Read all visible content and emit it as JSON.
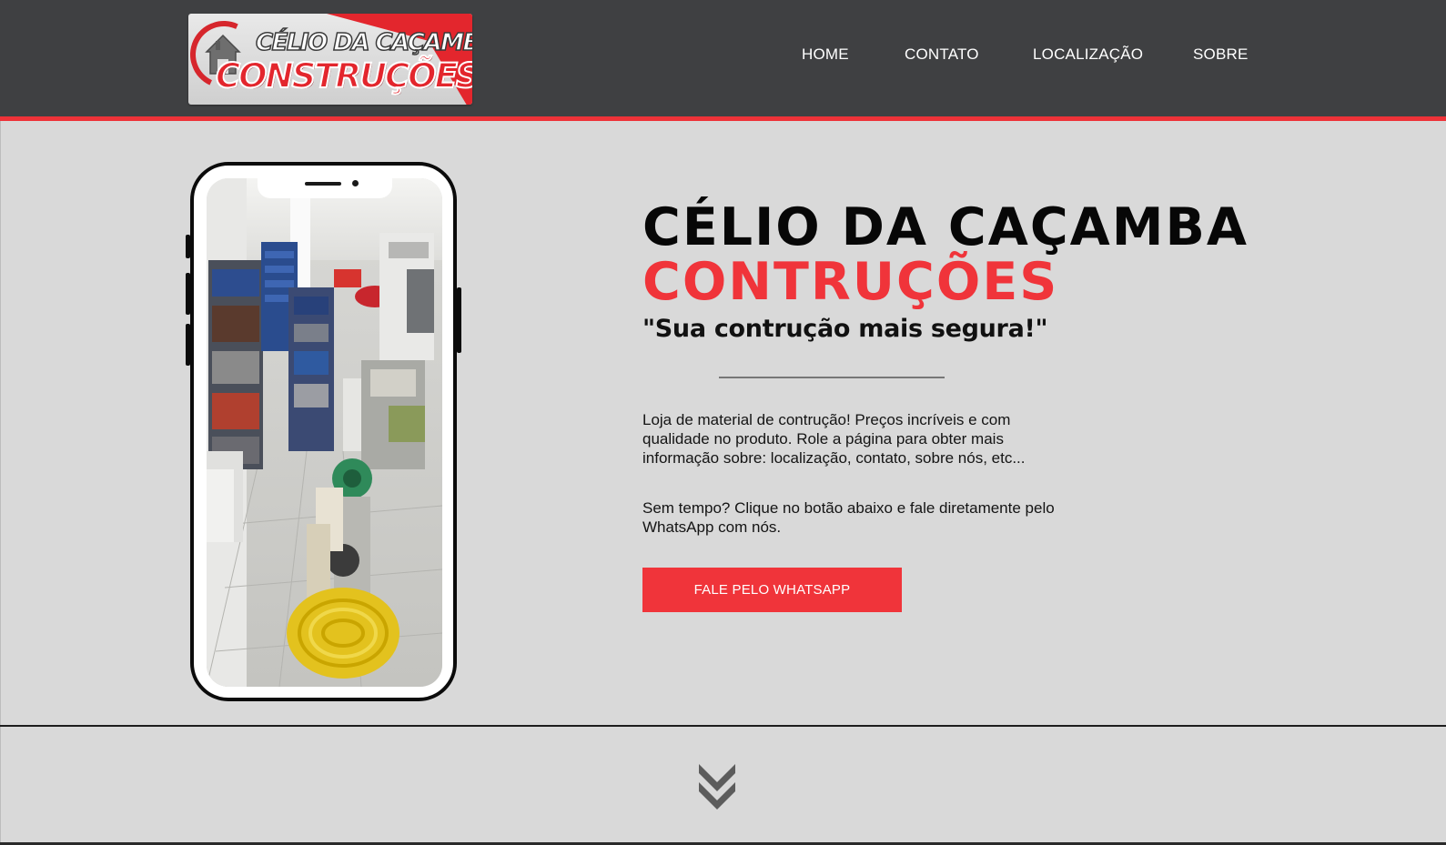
{
  "header": {
    "logo": {
      "line1": "CÉLIO DA CAÇAMBA",
      "line2": "CONSTRUÇÕES"
    },
    "nav": [
      {
        "label": "HOME"
      },
      {
        "label": "CONTATO"
      },
      {
        "label": "LOCALIZAÇÃO"
      },
      {
        "label": "SOBRE"
      }
    ]
  },
  "hero": {
    "title_line1": "CÉLIO DA CAÇAMBA",
    "title_line2": "CONTRUÇÕES",
    "slogan": "\"Sua contrução mais segura!\"",
    "paragraph1": "Loja de material de contrução! Preços incríveis e com qualidade no produto. Role a página para obter mais informação sobre: localização, contato, sobre nós, etc...",
    "paragraph2": "Sem tempo? Clique no botão abaixo e fale diretamente pelo WhatsApp com nós.",
    "cta_label": "FALE PELO WHATSAPP"
  },
  "icons": {
    "scroll": "double-chevron-down-icon",
    "phone_image": "store-interior-photo"
  },
  "colors": {
    "header_bg": "#3f4042",
    "accent_red": "#f0343a",
    "page_bg": "#d9d9d9",
    "text_dark": "#070707"
  }
}
